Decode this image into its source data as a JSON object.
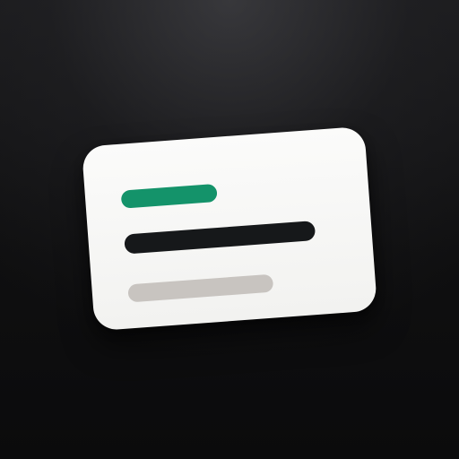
{
  "theme": {
    "background_top": "#2b2b2f",
    "background_bottom": "#0b0b0c",
    "card_background_top": "#fbfbfa",
    "card_background_bottom": "#f2f2f0",
    "accent_green": "#14936a",
    "text_dark": "#16181a",
    "muted_gray": "#c8c4c0"
  },
  "icons": {
    "card": "card-icon",
    "accent_line": "accent-line-icon",
    "dark_line": "dark-line-icon",
    "muted_line": "muted-line-icon"
  }
}
